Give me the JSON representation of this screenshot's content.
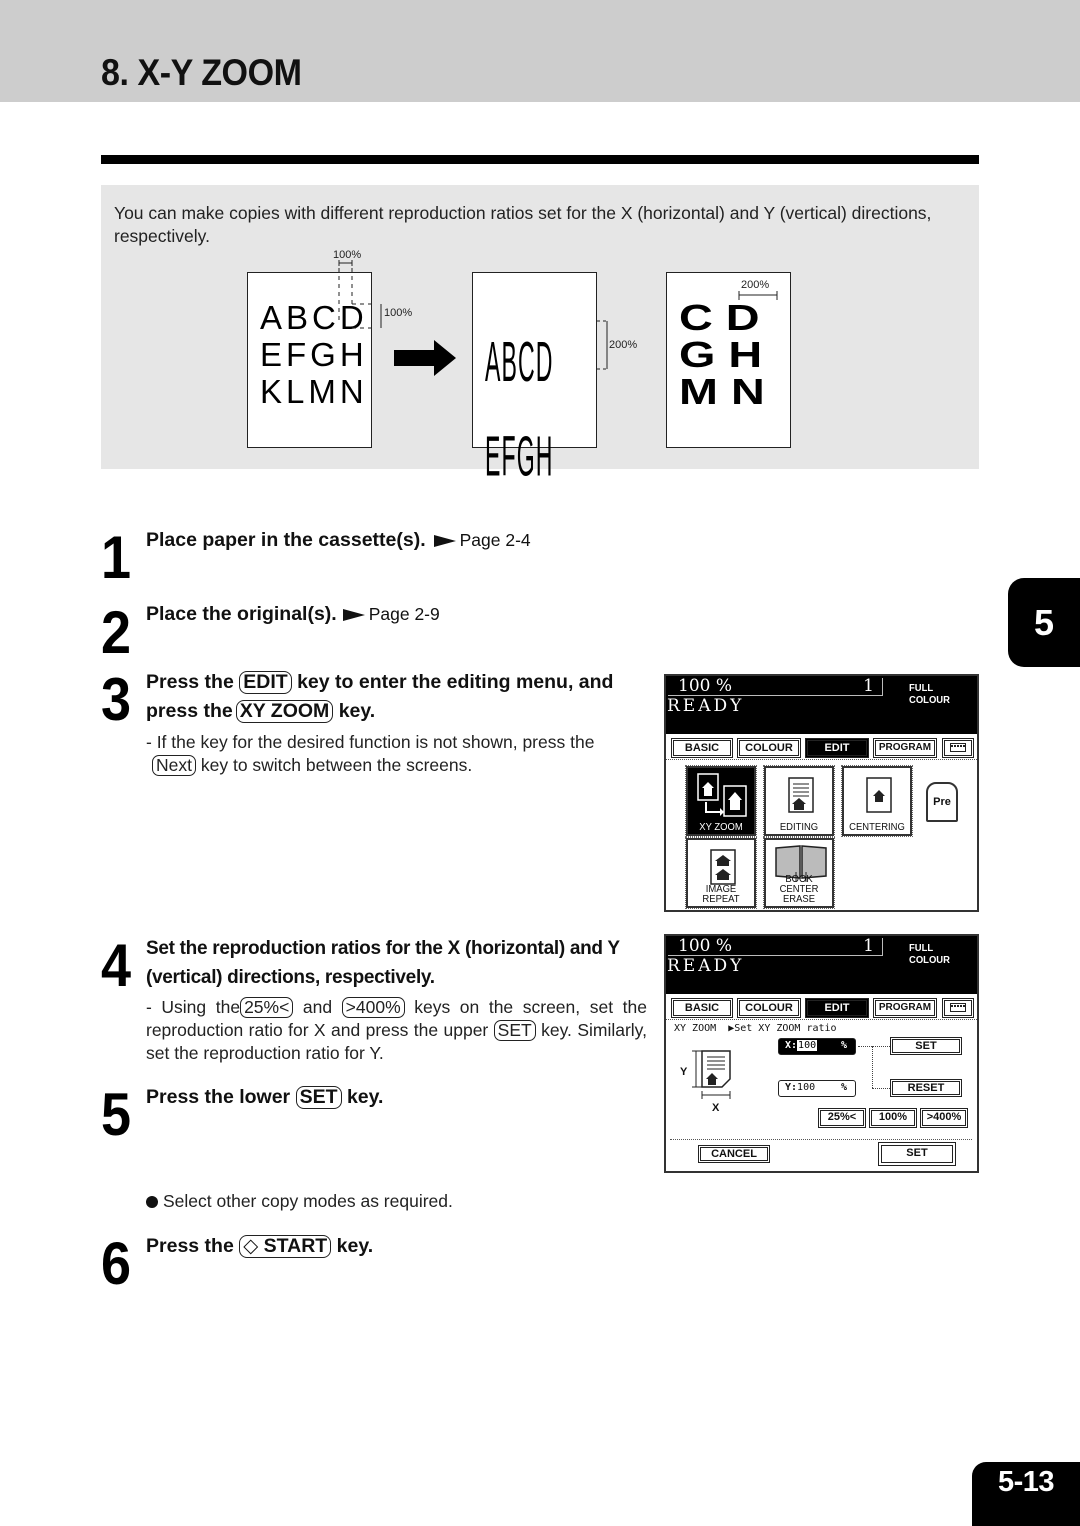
{
  "header": {
    "title": "8. X-Y ZOOM"
  },
  "intro": {
    "text": "You can make copies with different reproduction ratios set for the X (horizontal) and Y (vertical) directions, respectively.",
    "illustration": {
      "original_lines": [
        "ABCD",
        "EFGH",
        "KLMN"
      ],
      "vertical_stretch_lines": [
        "ABCD",
        "EFGH"
      ],
      "horizontal_stretch_lines": [
        "C D",
        "G H",
        "M N"
      ],
      "label_original_x": "100%",
      "label_original_y": "100%",
      "label_vertical": "200%",
      "label_horizontal": "200%"
    }
  },
  "steps": [
    {
      "number": "1",
      "title": "Place paper in the cassette(s).",
      "ref": "Page 2-4"
    },
    {
      "number": "2",
      "title": "Place the original(s).",
      "ref": "Page 2-9"
    },
    {
      "number": "3",
      "title_pre": "Press the",
      "key1": "EDIT",
      "title_mid": "key to enter the editing menu, and",
      "title_pre2": "press the",
      "key2": "XY ZOOM",
      "title_post": "key.",
      "note_pre": "- If the key for the desired function is not shown, press the",
      "note_key": "Next",
      "note_post": "key to switch between the screens."
    },
    {
      "number": "4",
      "title": "Set the reproduction ratios for the X (horizontal) and Y (vertical) directions, respectively.",
      "note_pre": "- Using the",
      "note_key1": "25%<",
      "note_and": "and",
      "note_key2": ">400%",
      "note_mid": "keys on the screen, set the reproduction ratio for X and press the upper",
      "note_key3": "SET",
      "note_post": "key. Similarly, set the reproduction ratio for Y."
    },
    {
      "number": "5",
      "title_pre": "Press the lower",
      "key": "SET",
      "title_post": "key."
    },
    {
      "number": "6",
      "title_pre": "Press the",
      "key": "START",
      "title_post": "key."
    }
  ],
  "bullet": "Select other copy modes as required.",
  "lcd_common": {
    "ratio": "100  %",
    "copies": "1",
    "mode": "FULL COLOUR",
    "status": "READY",
    "tabs": [
      "BASIC",
      "COLOUR",
      "EDIT",
      "PROGRAM"
    ],
    "active_tab": "EDIT"
  },
  "lcd1": {
    "functions": [
      "XY ZOOM",
      "EDITING",
      "CENTERING",
      "IMAGE REPEAT",
      "BOOK CENTER ERASE"
    ],
    "active_function": "XY ZOOM",
    "pre_label": "Pre"
  },
  "lcd2": {
    "breadcrumb": "XY ZOOM",
    "instruction": "▶Set XY ZOOM ratio",
    "x_label": "X:",
    "x_value": "100",
    "y_label": "Y:",
    "y_value": "100",
    "pct": "%",
    "axis_y": "Y",
    "axis_x": "X",
    "btn_set_upper": "SET",
    "btn_reset": "RESET",
    "btn_25": "25%<",
    "btn_100": "100%",
    "btn_400": ">400%",
    "btn_cancel": "CANCEL",
    "btn_set_lower": "SET"
  },
  "chapter_tab": "5",
  "page_number": "5-13"
}
